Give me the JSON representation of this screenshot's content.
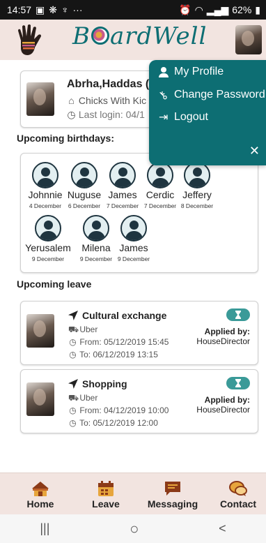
{
  "statusbar": {
    "time": "14:57",
    "dots": "···",
    "battery": "62%"
  },
  "header": {
    "brand": "BoardWell",
    "brand_prefix": "B",
    "brand_suffix": "ardWell",
    "teal": "#0d6e73"
  },
  "profile": {
    "name": "Abrha,Haddas (A",
    "school": "Chicks With Kic",
    "last_login": "Last login: 04/1"
  },
  "birthdays": {
    "title": "Upcoming birthdays:",
    "people": [
      {
        "name": "Johnnie",
        "date": "4 December"
      },
      {
        "name": "Nuguse",
        "date": "6 December"
      },
      {
        "name": "James",
        "date": "7 December"
      },
      {
        "name": "Cerdic",
        "date": "7 December"
      },
      {
        "name": "Jeffery",
        "date": "8 December"
      },
      {
        "name": "Yerusalem",
        "date": "9 December"
      },
      {
        "name": "Milena",
        "date": "9 December"
      },
      {
        "name": "James",
        "date": "9 December"
      }
    ]
  },
  "leave": {
    "title": "Upcoming leave",
    "applied_label": "Applied by:",
    "items": [
      {
        "title": "Cultural exchange",
        "transport": "Uber",
        "from": "From: 05/12/2019 15:45",
        "to": "To: 06/12/2019 13:15",
        "applied_by": "HouseDirector"
      },
      {
        "title": "Shopping",
        "transport": "Uber",
        "from": "From: 04/12/2019 10:00",
        "to": "To: 05/12/2019 12:00",
        "applied_by": "HouseDirector"
      }
    ]
  },
  "menu": {
    "items": [
      {
        "label": "My Profile",
        "icon": "user-icon"
      },
      {
        "label": "Change Password",
        "icon": "key-icon"
      },
      {
        "label": "Logout",
        "icon": "logout-icon"
      }
    ],
    "close": "✕"
  },
  "nav": {
    "items": [
      {
        "label": "Home",
        "icon": "home-icon"
      },
      {
        "label": "Leave",
        "icon": "calendar-icon"
      },
      {
        "label": "Messaging",
        "icon": "message-icon"
      },
      {
        "label": "Contact",
        "icon": "contact-icon"
      }
    ]
  },
  "sysnav": {
    "recent": "|||",
    "home": "○",
    "back": "<"
  }
}
